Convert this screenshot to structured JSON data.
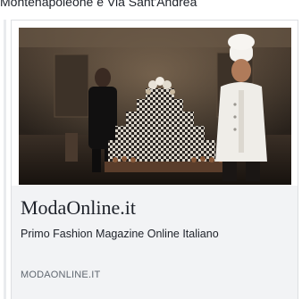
{
  "post": {
    "text": "Montenapoleone e Via Sant'Andrea"
  },
  "link_preview": {
    "image_alt": "ModaOnline.it",
    "title": "ModaOnline.it",
    "description": "Primo Fashion Magazine Online Italiano",
    "domain": "MODAONLINE.IT"
  }
}
